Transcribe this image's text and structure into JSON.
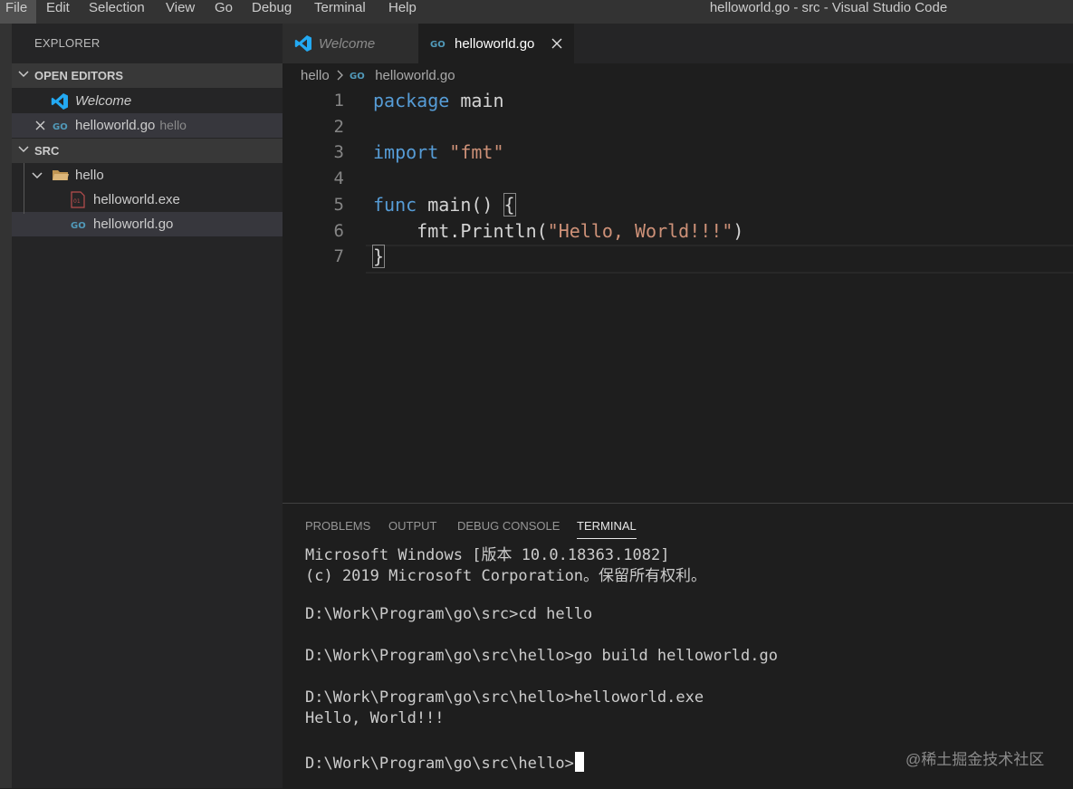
{
  "menu": {
    "items": [
      "File",
      "Edit",
      "Selection",
      "View",
      "Go",
      "Debug",
      "Terminal",
      "Help"
    ],
    "window_title": "helloworld.go - src - Visual Studio Code"
  },
  "explorer": {
    "title": "EXPLORER",
    "open_editors": {
      "label": "OPEN EDITORS",
      "items": [
        {
          "name": "Welcome",
          "desc": ""
        },
        {
          "name": "helloworld.go",
          "desc": "hello"
        }
      ]
    },
    "src": {
      "label": "SRC",
      "folder": "hello",
      "files": [
        "helloworld.exe",
        "helloworld.go"
      ]
    }
  },
  "tabs": [
    {
      "label": "Welcome"
    },
    {
      "label": "helloworld.go"
    }
  ],
  "breadcrumb": {
    "folder": "hello",
    "file": "helloworld.go"
  },
  "editor": {
    "line_numbers": [
      "1",
      "2",
      "3",
      "4",
      "5",
      "6",
      "7"
    ],
    "code": {
      "l1_kw": "package",
      "l1_rest": " main",
      "l3_kw": "import",
      "l3_str": "\"fmt\"",
      "l5_kw": "func",
      "l5_name": "main",
      "l5_rest": "() ",
      "l5_brace": "{",
      "l6_pre": "    fmt.",
      "l6_fn": "Println",
      "l6_open": "(",
      "l6_str": "\"Hello, World!!!\"",
      "l6_close": ")",
      "l7": "}"
    }
  },
  "panel": {
    "tabs": [
      "PROBLEMS",
      "OUTPUT",
      "DEBUG CONSOLE",
      "TERMINAL"
    ],
    "active_tab": "TERMINAL",
    "terminal_lines": [
      "Microsoft Windows [版本 10.0.18363.1082]",
      "(c) 2019 Microsoft Corporation。保留所有权利。",
      "D:\\Work\\Program\\go\\src>cd hello",
      "D:\\Work\\Program\\go\\src\\hello>go build helloworld.go",
      "D:\\Work\\Program\\go\\src\\hello>helloworld.exe",
      "Hello, World!!!",
      "D:\\Work\\Program\\go\\src\\hello>"
    ]
  },
  "watermark": "@稀土掘金技术社区",
  "colors": {
    "accent_blue": "#569cd6",
    "string": "#ce9178",
    "go_icon": "#519aba",
    "vscode_blue": "#23a9f2"
  }
}
